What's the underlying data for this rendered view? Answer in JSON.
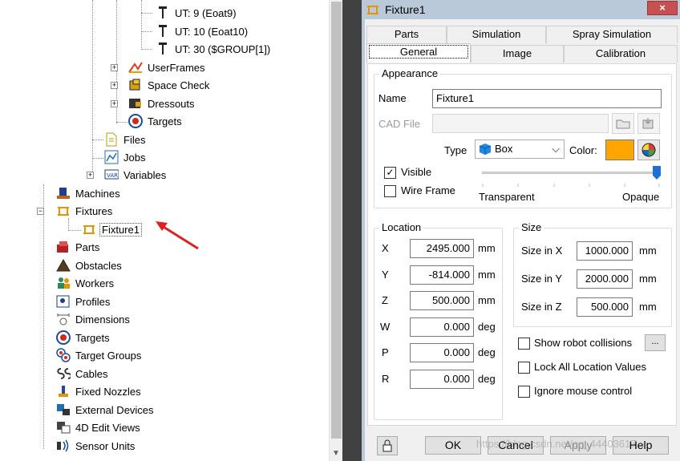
{
  "tree": {
    "items": [
      {
        "label": "UT: 9  (Eoat9)",
        "icon": "tool-icon"
      },
      {
        "label": "UT: 10  (Eoat10)",
        "icon": "tool-icon"
      },
      {
        "label": "UT: 30  ($GROUP[1])",
        "icon": "tool-icon"
      },
      {
        "label": "UserFrames",
        "icon": "userframes-icon"
      },
      {
        "label": "Space Check",
        "icon": "space-check-icon"
      },
      {
        "label": "Dressouts",
        "icon": "dressouts-icon"
      },
      {
        "label": "Targets",
        "icon": "target-icon"
      },
      {
        "label": "Files",
        "icon": "file-icon"
      },
      {
        "label": "Jobs",
        "icon": "jobs-icon"
      },
      {
        "label": "Variables",
        "icon": "variables-icon"
      },
      {
        "label": "Machines",
        "icon": "machines-icon"
      },
      {
        "label": "Fixtures",
        "icon": "fixture-icon"
      },
      {
        "label": "Fixture1",
        "icon": "fixture-icon"
      },
      {
        "label": "Parts",
        "icon": "parts-icon"
      },
      {
        "label": "Obstacles",
        "icon": "obstacles-icon"
      },
      {
        "label": "Workers",
        "icon": "workers-icon"
      },
      {
        "label": "Profiles",
        "icon": "profiles-icon"
      },
      {
        "label": "Dimensions",
        "icon": "dimensions-icon"
      },
      {
        "label": "Targets",
        "icon": "target-icon"
      },
      {
        "label": "Target Groups",
        "icon": "target-groups-icon"
      },
      {
        "label": "Cables",
        "icon": "cables-icon"
      },
      {
        "label": "Fixed Nozzles",
        "icon": "nozzle-icon"
      },
      {
        "label": "External Devices",
        "icon": "external-devices-icon"
      },
      {
        "label": "4D Edit Views",
        "icon": "edit-views-icon"
      },
      {
        "label": "Sensor Units",
        "icon": "sensor-icon"
      }
    ]
  },
  "dialog": {
    "title": "Fixture1",
    "close": "×",
    "tabs_row1": [
      "Parts",
      "Simulation",
      "Spray Simulation"
    ],
    "tabs_row2": [
      "General",
      "Image",
      "Calibration"
    ],
    "appearance": {
      "group_title": "Appearance",
      "name_label": "Name",
      "name_value": "Fixture1",
      "cad_label": "CAD File",
      "cad_value": "",
      "type_label": "Type",
      "type_value": "Box",
      "color_label": "Color:",
      "color_value": "#ffa500",
      "visible_label": "Visible",
      "visible_checked": true,
      "wireframe_label": "Wire Frame",
      "wireframe_checked": false,
      "transparent_label": "Transparent",
      "opaque_label": "Opaque",
      "opacity": 1.0
    },
    "location": {
      "group_title": "Location",
      "rows": [
        {
          "axis": "X",
          "value": "2495.000",
          "unit": "mm"
        },
        {
          "axis": "Y",
          "value": "-814.000",
          "unit": "mm"
        },
        {
          "axis": "Z",
          "value": "500.000",
          "unit": "mm"
        },
        {
          "axis": "W",
          "value": "0.000",
          "unit": "deg"
        },
        {
          "axis": "P",
          "value": "0.000",
          "unit": "deg"
        },
        {
          "axis": "R",
          "value": "0.000",
          "unit": "deg"
        }
      ]
    },
    "size": {
      "group_title": "Size",
      "rows": [
        {
          "label": "Size in X",
          "value": "1000.000",
          "unit": "mm"
        },
        {
          "label": "Size in Y",
          "value": "2000.000",
          "unit": "mm"
        },
        {
          "label": "Size in Z",
          "value": "500.000",
          "unit": "mm"
        }
      ]
    },
    "options": {
      "show_collisions": "Show robot collisions",
      "ellipsis": "...",
      "lock_values": "Lock All Location Values",
      "ignore_mouse": "Ignore mouse control"
    },
    "buttons": {
      "ok": "OK",
      "cancel": "Cancel",
      "apply": "Apply",
      "help": "Help"
    },
    "watermark": "https://blog.csdn.net/qq_44403617"
  },
  "colors": {
    "accent_arrow": "#e02020",
    "color_swatch": "#ffa500",
    "title_bar": "#b9c9da",
    "close_button": "#c75050"
  }
}
